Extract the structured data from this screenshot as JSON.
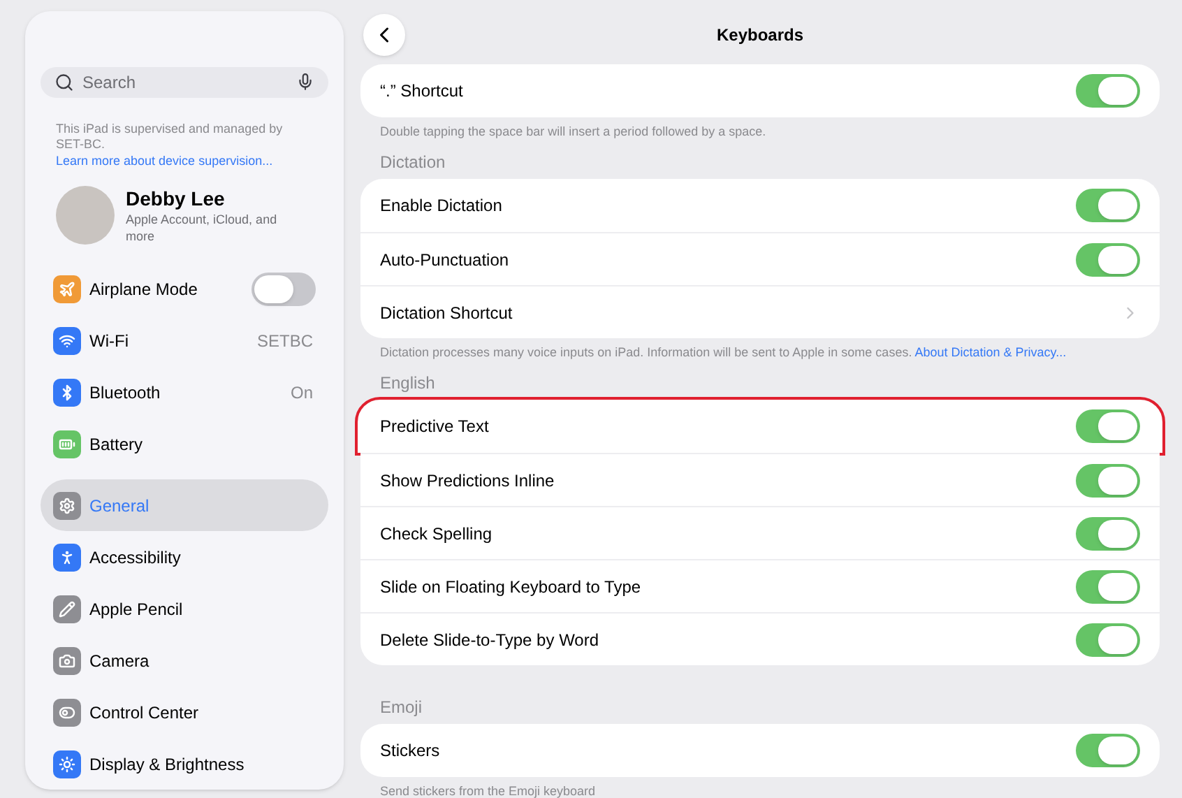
{
  "sidebar": {
    "search": {
      "placeholder": "Search"
    },
    "supervision": {
      "text": "This iPad is supervised and managed by SET-BC.",
      "link": "Learn more about device supervision..."
    },
    "profile": {
      "name": "Debby Lee",
      "subtitle": "Apple Account, iCloud, and more"
    },
    "groups": [
      [
        {
          "label": "Airplane Mode",
          "color": "#f09a37",
          "kind": "toggle",
          "on": false,
          "selected": false
        },
        {
          "label": "Wi-Fi",
          "color": "#3478f6",
          "kind": "value",
          "value": "SETBC",
          "selected": false
        },
        {
          "label": "Bluetooth",
          "color": "#3478f6",
          "kind": "value",
          "value": "On",
          "selected": false
        },
        {
          "label": "Battery",
          "color": "#65c466",
          "kind": "plain",
          "selected": false
        }
      ],
      [
        {
          "label": "General",
          "color": "#8e8e93",
          "kind": "plain",
          "selected": true
        },
        {
          "label": "Accessibility",
          "color": "#3478f6",
          "kind": "plain",
          "selected": false
        },
        {
          "label": "Apple Pencil",
          "color": "#8e8e93",
          "kind": "plain",
          "selected": false
        },
        {
          "label": "Camera",
          "color": "#8e8e93",
          "kind": "plain",
          "selected": false
        },
        {
          "label": "Control Center",
          "color": "#8e8e93",
          "kind": "plain",
          "selected": false
        },
        {
          "label": "Display & Brightness",
          "color": "#3478f6",
          "kind": "plain",
          "selected": false
        }
      ]
    ]
  },
  "header": {
    "title": "Keyboards"
  },
  "sections": [
    {
      "rows": [
        {
          "label": "“.” Shortcut",
          "kind": "toggle",
          "on": true,
          "faded": false,
          "highlighted": false
        }
      ],
      "footer": "Double tapping the space bar will insert a period followed by a space."
    },
    {
      "title": "Dictation",
      "rows": [
        {
          "label": "Enable Dictation",
          "kind": "toggle",
          "on": true,
          "faded": false,
          "highlighted": false
        },
        {
          "label": "Auto-Punctuation",
          "kind": "toggle",
          "on": true,
          "faded": false,
          "highlighted": false
        },
        {
          "label": "Dictation Shortcut",
          "kind": "link",
          "faded": false,
          "highlighted": false
        }
      ],
      "footer": "Dictation processes many voice inputs on iPad. Information will be sent to Apple in some cases.",
      "footer_link": "About Dictation & Privacy..."
    },
    {
      "title": "English",
      "rows": [
        {
          "label": "Predictive Text",
          "kind": "toggle",
          "on": true,
          "faded": false,
          "highlighted": true
        },
        {
          "label": "Show Predictions Inline",
          "kind": "toggle",
          "on": true,
          "faded": false,
          "highlighted": false
        },
        {
          "label": "Check Spelling",
          "kind": "toggle",
          "on": true,
          "faded": false,
          "highlighted": false
        },
        {
          "label": "Slide on Floating Keyboard to Type",
          "kind": "toggle",
          "on": true,
          "faded": false,
          "highlighted": false
        },
        {
          "label": "Delete Slide-to-Type by Word",
          "kind": "toggle",
          "on": true,
          "faded": false,
          "highlighted": false
        }
      ]
    },
    {
      "title": "Emoji",
      "rows": [
        {
          "label": "Stickers",
          "kind": "toggle",
          "on": true,
          "faded": false,
          "highlighted": false
        }
      ],
      "footer": "Send stickers from the Emoji keyboard"
    }
  ]
}
